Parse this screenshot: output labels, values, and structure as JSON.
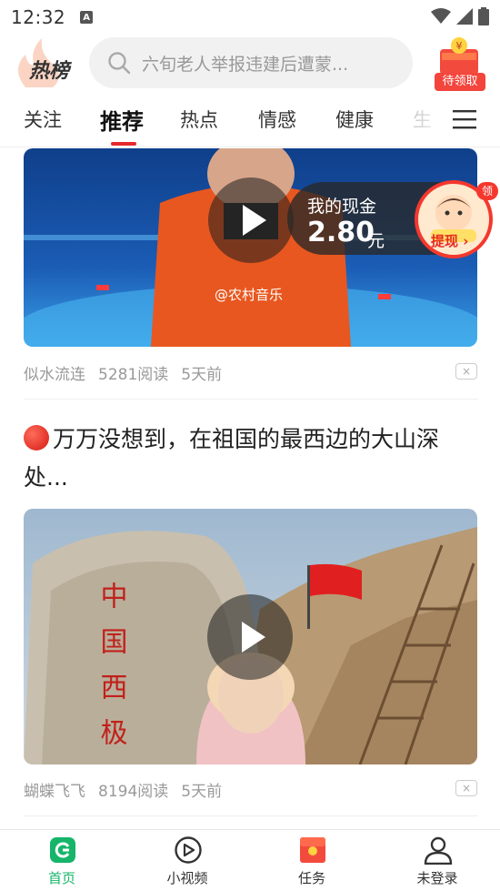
{
  "status_bar": {
    "time": "12:32",
    "notif_letter": "A"
  },
  "header": {
    "logo_text": "热榜",
    "search_placeholder": "六旬老人举报违建后遭蒙...",
    "gift_label": "待领取",
    "gift_coin": "¥"
  },
  "tabs": [
    {
      "label": "关注",
      "active": false
    },
    {
      "label": "推荐",
      "active": true
    },
    {
      "label": "热点",
      "active": false
    },
    {
      "label": "情感",
      "active": false
    },
    {
      "label": "健康",
      "active": false
    },
    {
      "label": "生",
      "active": false
    }
  ],
  "feed": {
    "item1": {
      "watermark": "@农村音乐",
      "author": "似水流连",
      "reads": "5281阅读",
      "time": "5天前",
      "close": "×"
    },
    "item2": {
      "title": "万万没想到，在祖国的最西边的大山深处...",
      "stone_text": "中国西极",
      "author": "蝴蝶飞飞",
      "reads": "8194阅读",
      "time": "5天前",
      "close": "×"
    }
  },
  "cash_widget": {
    "label": "我的现金",
    "amount": "2.80",
    "unit": "元",
    "withdraw": "提现",
    "badge": "领"
  },
  "bottom_nav": [
    {
      "label": "首页",
      "icon": "home-icon",
      "active": true
    },
    {
      "label": "小视频",
      "icon": "play-circle-icon",
      "active": false
    },
    {
      "label": "任务",
      "icon": "task-gift-icon",
      "active": false
    },
    {
      "label": "未登录",
      "icon": "user-icon",
      "active": false
    }
  ],
  "colors": {
    "accent_red": "#e6282b",
    "active_green": "#16b56a"
  }
}
